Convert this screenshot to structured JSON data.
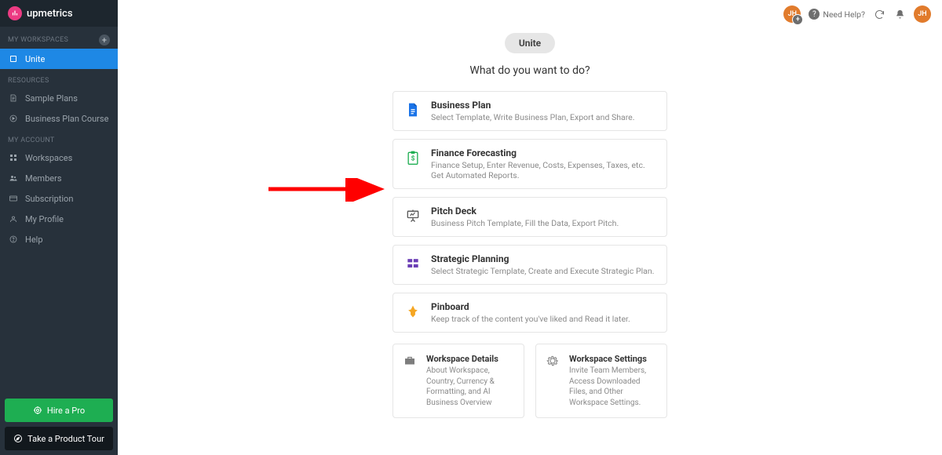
{
  "brand": "upmetrics",
  "sidebar": {
    "sections": {
      "workspaces_header": "MY WORKSPACES",
      "resources_header": "RESOURCES",
      "account_header": "MY ACCOUNT"
    },
    "workspace_items": [
      "Unite"
    ],
    "resource_items": [
      "Sample Plans",
      "Business Plan Course"
    ],
    "account_items": [
      "Workspaces",
      "Members",
      "Subscription",
      "My Profile",
      "Help"
    ]
  },
  "buttons": {
    "hire": "Hire a Pro",
    "tour": "Take a Product Tour"
  },
  "topbar": {
    "avatar_initials": "JH",
    "need_help": "Need Help?"
  },
  "page": {
    "workspace_name": "Unite",
    "prompt": "What do you want to do?"
  },
  "options": [
    {
      "title": "Business Plan",
      "desc": "Select Template, Write Business Plan, Export and Share."
    },
    {
      "title": "Finance Forecasting",
      "desc": "Finance Setup, Enter Revenue, Costs, Expenses, Taxes, etc. Get Automated Reports."
    },
    {
      "title": "Pitch Deck",
      "desc": "Business Pitch Template, Fill the Data, Export Pitch."
    },
    {
      "title": "Strategic Planning",
      "desc": "Select Strategic Template, Create and Execute Strategic Plan."
    },
    {
      "title": "Pinboard",
      "desc": "Keep track of the content you've liked and Read it later."
    }
  ],
  "cards": [
    {
      "title": "Workspace Details",
      "desc": "About Workspace, Country, Currency & Formatting, and AI Business Overview"
    },
    {
      "title": "Workspace Settings",
      "desc": "Invite Team Members, Access Downloaded Files, and Other Workspace Settings."
    }
  ],
  "colors": {
    "business_plan": "#1a73e8",
    "finance": "#1eae52",
    "pitch": "#5a5a5a",
    "strategic": "#6a3db5",
    "pinboard": "#f5a623"
  }
}
